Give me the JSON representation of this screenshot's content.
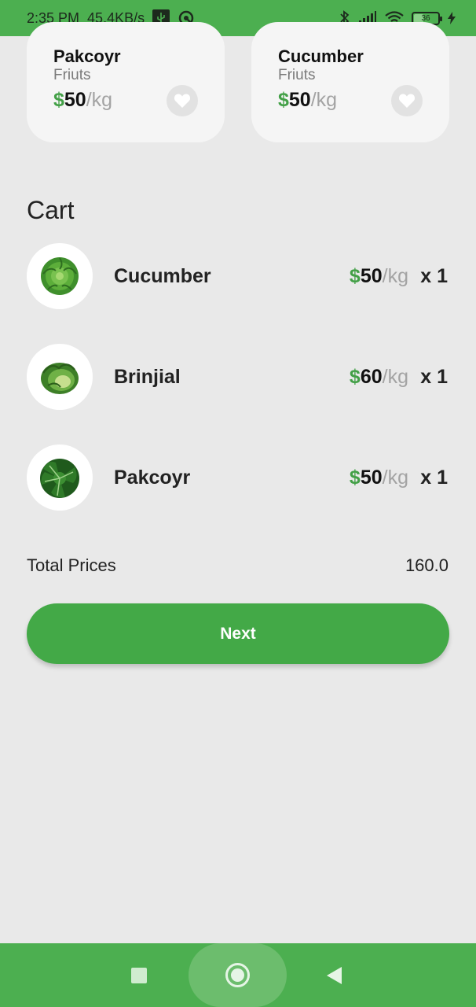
{
  "status_bar": {
    "time": "2:35 PM",
    "speed": "45.4KB/s",
    "battery": "36",
    "icons": [
      "usb-icon",
      "sync-icon",
      "bluetooth-icon",
      "signal-icon",
      "wifi-icon",
      "battery-icon",
      "charging-icon"
    ]
  },
  "products": [
    {
      "name": "Pakcoyr",
      "category": "Friuts",
      "currency": "$",
      "price": "50",
      "unit": "/kg"
    },
    {
      "name": "Cucumber",
      "category": "Friuts",
      "currency": "$",
      "price": "50",
      "unit": "/kg"
    }
  ],
  "cart": {
    "title": "Cart",
    "items": [
      {
        "name": "Cucumber",
        "currency": "$",
        "price": "50",
        "unit": "/kg",
        "qty": "x 1"
      },
      {
        "name": "Brinjial",
        "currency": "$",
        "price": "60",
        "unit": "/kg",
        "qty": "x 1"
      },
      {
        "name": "Pakcoyr",
        "currency": "$",
        "price": "50",
        "unit": "/kg",
        "qty": "x 1"
      }
    ],
    "total_label": "Total Prices",
    "total_value": "160.0",
    "next_label": "Next"
  },
  "colors": {
    "accent": "#43a947",
    "status_bar": "#4caf50",
    "background": "#e9e9e9"
  }
}
